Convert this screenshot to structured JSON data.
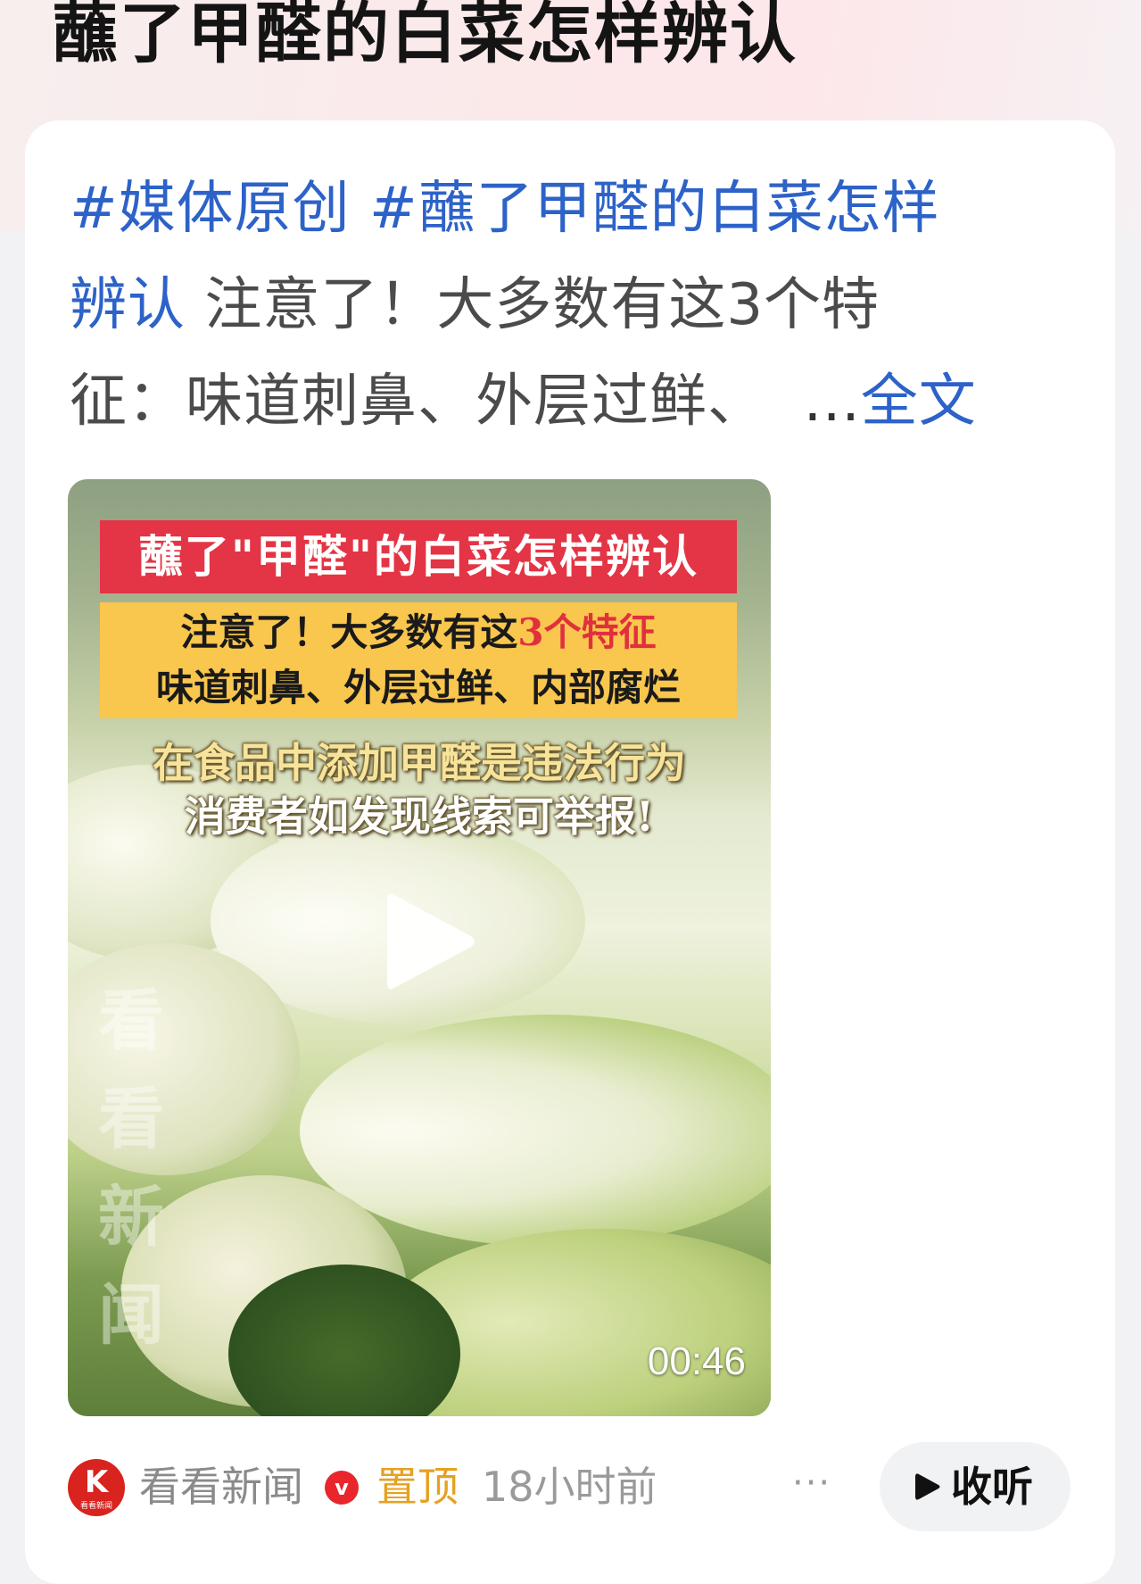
{
  "page_title": "蘸了甲醛的白菜怎样辨认",
  "post": {
    "hashtag_1": "#媒体原创",
    "hashtag_2": "#蘸了甲醛的白菜怎样",
    "hashtag_2_cont": "辨认",
    "text_1": " 注意了！大多数有这3个特",
    "text_2": "征：味道刺鼻、外层过鲜、",
    "ellipsis": "...",
    "more_link": "全文"
  },
  "video": {
    "banner_title": "蘸了\"甲醛\"的白菜怎样辨认",
    "feature_line1_prefix": "注意了！大多数有这",
    "feature_line1_highlight": "3个特征",
    "feature_line2": "味道刺鼻、外层过鲜、内部腐烂",
    "warning_line1": "在食品中添加甲醛是违法行为",
    "warning_line2": "消费者如发现线索可举报!",
    "watermark_line1": "看看",
    "watermark_line2": "新闻",
    "duration": "00:46",
    "play_icon": "play-icon"
  },
  "footer": {
    "avatar_letter": "K",
    "avatar_text": "看看新闻",
    "author": "看看新闻",
    "verified_badge": "v",
    "pinned": "置顶",
    "time": "18小时前",
    "more": "···",
    "listen_label": "收听"
  },
  "colors": {
    "link": "#2d62c8",
    "pinned": "#e6a122",
    "banner_red": "#e33545",
    "feature_yellow": "#f9c64e"
  }
}
